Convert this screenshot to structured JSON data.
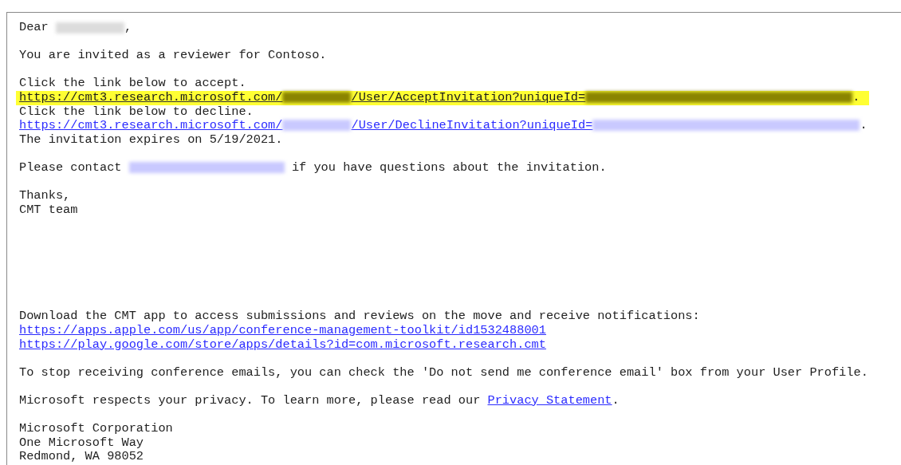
{
  "body": [
    {
      "lines": [
        {
          "highlighted": false,
          "parts": [
            {
              "kind": "text",
              "text": "Dear "
            },
            {
              "kind": "blurname"
            },
            {
              "kind": "text",
              "text": ","
            }
          ]
        }
      ]
    },
    {
      "lines": [
        {
          "highlighted": false,
          "parts": [
            {
              "kind": "text",
              "text": "You are invited as a reviewer for Contoso."
            }
          ]
        }
      ]
    },
    {
      "lines": [
        {
          "highlighted": false,
          "parts": [
            {
              "kind": "text",
              "text": "Click the link below to accept."
            }
          ]
        },
        {
          "highlighted": true,
          "parts": [
            {
              "kind": "link",
              "segments": [
                {
                  "kind": "text",
                  "text": "https://cmt3.research.microsoft.com/"
                },
                {
                  "kind": "blurpath"
                },
                {
                  "kind": "text",
                  "text": "/User/AcceptInvitation?uniqueId="
                },
                {
                  "kind": "blurid"
                }
              ]
            },
            {
              "kind": "text",
              "text": "."
            }
          ]
        },
        {
          "highlighted": false,
          "parts": [
            {
              "kind": "text",
              "text": "Click the link below to decline."
            }
          ]
        },
        {
          "highlighted": false,
          "parts": [
            {
              "kind": "link",
              "segments": [
                {
                  "kind": "text",
                  "text": "https://cmt3.research.microsoft.com/"
                },
                {
                  "kind": "blurpath"
                },
                {
                  "kind": "text",
                  "text": "/User/DeclineInvitation?uniqueId="
                },
                {
                  "kind": "blurid"
                }
              ]
            },
            {
              "kind": "text",
              "text": "."
            }
          ]
        },
        {
          "highlighted": false,
          "parts": [
            {
              "kind": "text",
              "text": "The invitation expires on 5/19/2021."
            }
          ]
        }
      ]
    },
    {
      "lines": [
        {
          "highlighted": false,
          "parts": [
            {
              "kind": "text",
              "text": "Please contact "
            },
            {
              "kind": "link",
              "segments": [
                {
                  "kind": "blurmail"
                }
              ]
            },
            {
              "kind": "text",
              "text": " if you have questions about the invitation."
            }
          ]
        }
      ]
    },
    {
      "lines": [
        {
          "highlighted": false,
          "parts": [
            {
              "kind": "text",
              "text": "Thanks,"
            }
          ]
        },
        {
          "highlighted": false,
          "parts": [
            {
              "kind": "text",
              "text": "CMT team"
            }
          ]
        }
      ]
    }
  ],
  "footer": [
    {
      "lines": [
        {
          "highlighted": false,
          "parts": [
            {
              "kind": "text",
              "text": "Download the CMT app to access submissions and reviews on the move and receive notifications:"
            }
          ]
        },
        {
          "highlighted": false,
          "parts": [
            {
              "kind": "link",
              "segments": [
                {
                  "kind": "text",
                  "text": "https://apps.apple.com/us/app/conference-management-toolkit/id1532488001"
                }
              ]
            }
          ]
        },
        {
          "highlighted": false,
          "parts": [
            {
              "kind": "link",
              "segments": [
                {
                  "kind": "text",
                  "text": "https://play.google.com/store/apps/details?id=com.microsoft.research.cmt"
                }
              ]
            }
          ]
        }
      ]
    },
    {
      "lines": [
        {
          "highlighted": false,
          "parts": [
            {
              "kind": "text",
              "text": "To stop receiving conference emails, you can check the 'Do not send me conference email' box from your User Profile."
            }
          ]
        }
      ]
    },
    {
      "lines": [
        {
          "highlighted": false,
          "parts": [
            {
              "kind": "text",
              "text": "Microsoft respects your privacy. To learn more, please read our "
            },
            {
              "kind": "link",
              "segments": [
                {
                  "kind": "text",
                  "text": "Privacy Statement"
                }
              ]
            },
            {
              "kind": "text",
              "text": "."
            }
          ]
        }
      ]
    },
    {
      "lines": [
        {
          "highlighted": false,
          "parts": [
            {
              "kind": "text",
              "text": "Microsoft Corporation"
            }
          ]
        },
        {
          "highlighted": false,
          "parts": [
            {
              "kind": "text",
              "text": "One Microsoft Way"
            }
          ]
        },
        {
          "highlighted": false,
          "parts": [
            {
              "kind": "text",
              "text": "Redmond, WA 98052"
            }
          ]
        }
      ]
    }
  ]
}
